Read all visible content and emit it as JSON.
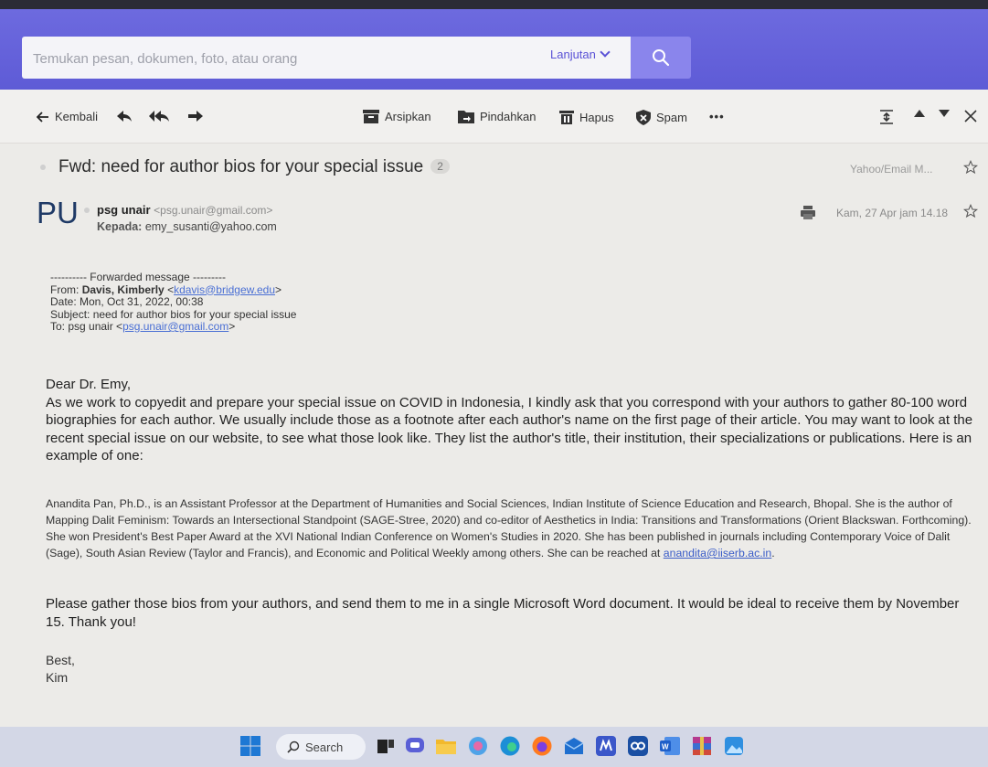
{
  "search": {
    "placeholder": "Temukan pesan, dokumen, foto, atau orang",
    "advanced_label": "Lanjutan"
  },
  "toolbar": {
    "back_label": "Kembali",
    "archive_label": "Arsipkan",
    "move_label": "Pindahkan",
    "delete_label": "Hapus",
    "spam_label": "Spam",
    "more_label": "•••"
  },
  "message": {
    "subject": "Fwd: need for author bios for your special issue",
    "thread_count": "2",
    "folder": "Yahoo/Email M...",
    "avatar_initials": "PU",
    "sender_name": "psg unair",
    "sender_email": "<psg.unair@gmail.com>",
    "to_label": "Kepada:",
    "to_address": "emy_susanti@yahoo.com",
    "date": "Kam, 27 Apr jam 14.18"
  },
  "forwarded": {
    "header": "---------- Forwarded message ---------",
    "from_label": "From:",
    "from_name": "Davis, Kimberly",
    "from_email": "kdavis@bridgew.edu",
    "date_line": "Date: Mon, Oct 31, 2022, 00:38",
    "subject_line": "Subject: need for author bios for your special issue",
    "to_label": "To: psg unair",
    "to_email": "psg.unair@gmail.com"
  },
  "body": {
    "greeting": "Dear Dr. Emy,",
    "paragraph1": "As we work to copyedit and prepare your special issue on COVID in Indonesia, I kindly ask that you correspond with your authors to gather 80-100 word biographies for each author. We usually include those as a footnote after each author's name on the first page of their article. You may want to look at the recent special issue on our website, to see what those look like. They list the author's title, their institution, their specializations or publications. Here is an example of one:",
    "example": "Anandita Pan, Ph.D., is an Assistant Professor at the Department of Humanities and Social Sciences, Indian Institute of Science Education and Research, Bhopal. She is the author of Mapping Dalit Feminism: Towards an Intersectional Standpoint (SAGE-Stree, 2020) and co-editor of Aesthetics in India: Transitions and Transformations (Orient Blackswan. Forthcoming). She won President's Best Paper Award at the XVI National Indian Conference on Women's Studies in 2020.  She has been published in journals including Contemporary Voice of Dalit (Sage), South Asian Review (Taylor and Francis), and Economic and Political Weekly among others. She can be reached at ",
    "example_email": "anandita@iiserb.ac.in",
    "example_end": ".",
    "paragraph2": "Please gather those bios from your authors, and send them to me in a single Microsoft Word document. It would be ideal to receive them by November 15. Thank you!",
    "signoff": "Best,",
    "signature": "Kim"
  },
  "taskbar": {
    "search_label": "Search"
  },
  "colors": {
    "accent": "#5e5bd6",
    "link": "#4a6fd4"
  }
}
